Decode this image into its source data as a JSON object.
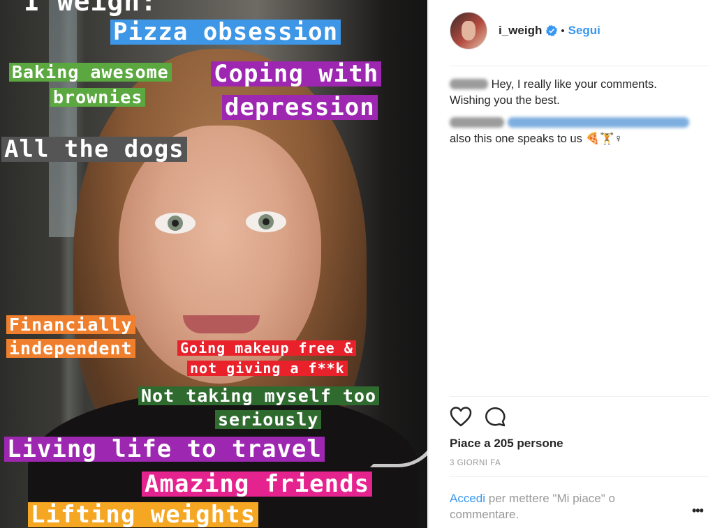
{
  "photo": {
    "tags": [
      {
        "name": "tag-i-weigh",
        "text": "I weigh:",
        "bg": "transparent"
      },
      {
        "name": "tag-pizza",
        "text": "Pizza obsession",
        "bg": "#3d96e6"
      },
      {
        "name": "tag-baking-1",
        "text": "Baking awesome",
        "bg": "#5aa83f"
      },
      {
        "name": "tag-baking-2",
        "text": "brownies",
        "bg": "#5aa83f"
      },
      {
        "name": "tag-coping-1",
        "text": "Coping with",
        "bg": "#9d27b0"
      },
      {
        "name": "tag-coping-2",
        "text": "depression",
        "bg": "#9d27b0"
      },
      {
        "name": "tag-dogs",
        "text": "All the dogs",
        "bg": "#555555"
      },
      {
        "name": "tag-financially",
        "text": "Financially",
        "bg": "#ef7f2d"
      },
      {
        "name": "tag-independent",
        "text": "independent",
        "bg": "#ef7f2d"
      },
      {
        "name": "tag-makeup-1",
        "text": "Going makeup free &",
        "bg": "#e8212b"
      },
      {
        "name": "tag-makeup-2",
        "text": "not giving a f**k",
        "bg": "#e8212b"
      },
      {
        "name": "tag-serious-1",
        "text": "Not taking myself too",
        "bg": "#2f6b2e"
      },
      {
        "name": "tag-serious-2",
        "text": "seriously",
        "bg": "#2f6b2e"
      },
      {
        "name": "tag-travel",
        "text": "Living life to travel",
        "bg": "#9d27b0"
      },
      {
        "name": "tag-friends",
        "text": "Amazing friends",
        "bg": "#e5238e"
      },
      {
        "name": "tag-lifting",
        "text": "Lifting weights",
        "bg": "#f5a623"
      }
    ]
  },
  "header": {
    "username": "i_weigh",
    "separator": "•",
    "follow_label": "Segui"
  },
  "comments": [
    {
      "text": "Hey, I really like your comments. Wishing you the best."
    },
    {
      "text": "also this one speaks to us 🍕🏋♀"
    }
  ],
  "actions": {
    "like_icon": "heart-icon",
    "comment_icon": "comment-icon"
  },
  "likes_label": "Piace a 205 persone",
  "timestamp": "3 GIORNI FA",
  "login": {
    "link": "Accedi",
    "text": " per mettere \"Mi piace\" o commentare."
  },
  "more_label": "•••",
  "colors": {
    "accent": "#3897f0",
    "text": "#262626",
    "muted": "#999999"
  }
}
